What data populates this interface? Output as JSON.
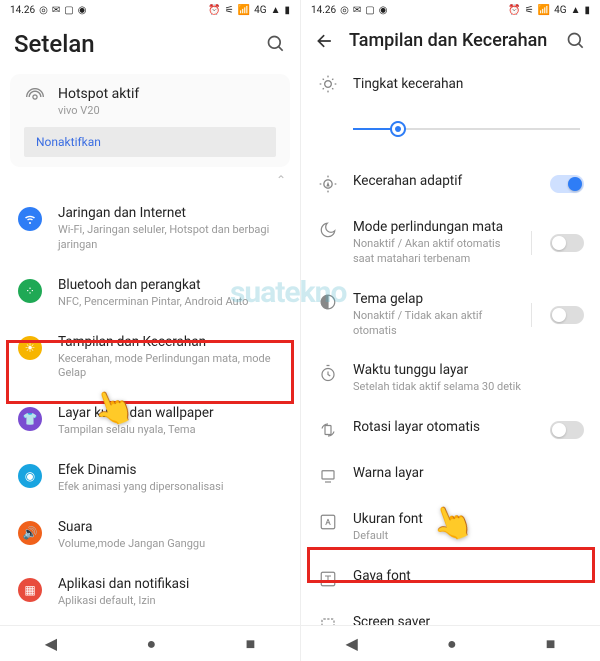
{
  "statusbar": {
    "time": "14.26",
    "network": "4G"
  },
  "left_screen": {
    "title": "Setelan",
    "hotspot": {
      "title": "Hotspot aktif",
      "device": "vivo V20",
      "deactivate": "Nonaktifkan"
    },
    "items": [
      {
        "label": "Jaringan dan Internet",
        "sub": "Wi-Fi, Jaringan seluler, Hotspot dan berbagi jaringan"
      },
      {
        "label": "Bluetooh dan perangkat",
        "sub": "NFC, Pencerminan Pintar, Android Auto"
      },
      {
        "label": "Tampilan dan Kecerahan",
        "sub": "Kecerahan, mode Perlindungan mata, mode Gelap"
      },
      {
        "label": "Layar kunci dan wallpaper",
        "sub": "Tampilan selalu nyala, Tema"
      },
      {
        "label": "Efek Dinamis",
        "sub": "Efek animasi yang dipersonalisasi"
      },
      {
        "label": "Suara",
        "sub": "Volume,mode Jangan Ganggu"
      },
      {
        "label": "Aplikasi dan notifikasi",
        "sub": "Aplikasi default, Izin"
      }
    ]
  },
  "right_screen": {
    "title": "Tampilan dan Kecerahan",
    "brightness_label": "Tingkat kecerahan",
    "items": [
      {
        "label": "Kecerahan adaptif"
      },
      {
        "label": "Mode perlindungan mata",
        "sub": "Nonaktif / Akan aktif otomatis saat matahari terbenam"
      },
      {
        "label": "Tema gelap",
        "sub": "Nonaktif / Tidak akan aktif otomatis"
      },
      {
        "label": "Waktu tunggu layar",
        "sub": "Setelah tidak aktif selama 30 detik"
      },
      {
        "label": "Rotasi layar otomatis"
      },
      {
        "label": "Warna layar"
      },
      {
        "label": "Ukuran font",
        "sub": "Default"
      },
      {
        "label": "Gaya font"
      },
      {
        "label": "Screen saver"
      }
    ]
  },
  "watermark": "suatekno"
}
